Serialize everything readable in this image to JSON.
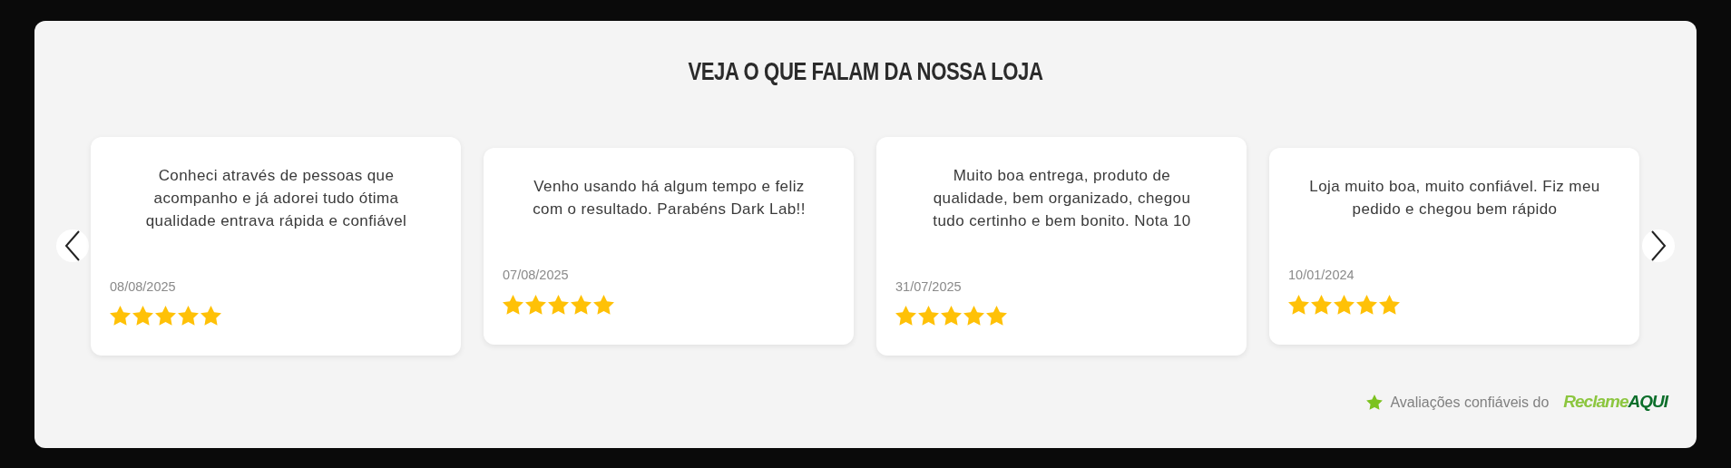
{
  "title": "VEJA O QUE FALAM DA NOSSA LOJA",
  "reviews": [
    {
      "text": "Conheci através de pessoas que acompanho e já adorei tudo ótima qualidade entrava rápida e confiável",
      "date": "08/08/2025",
      "stars": 5
    },
    {
      "text": "Venho usando há algum tempo e feliz com o resultado. Parabéns Dark Lab!!",
      "date": "07/08/2025",
      "stars": 5
    },
    {
      "text": "Muito boa entrega, produto de qualidade, bem organizado, chegou tudo certinho e bem bonito. Nota 10",
      "date": "31/07/2025",
      "stars": 5
    },
    {
      "text": "Loja muito boa, muito confiável. Fiz meu pedido e chegou bem rápido",
      "date": "10/01/2024",
      "stars": 5
    }
  ],
  "footer": {
    "text": "Avaliações confiáveis do",
    "brand": [
      "Reclame",
      "AQUI"
    ]
  }
}
